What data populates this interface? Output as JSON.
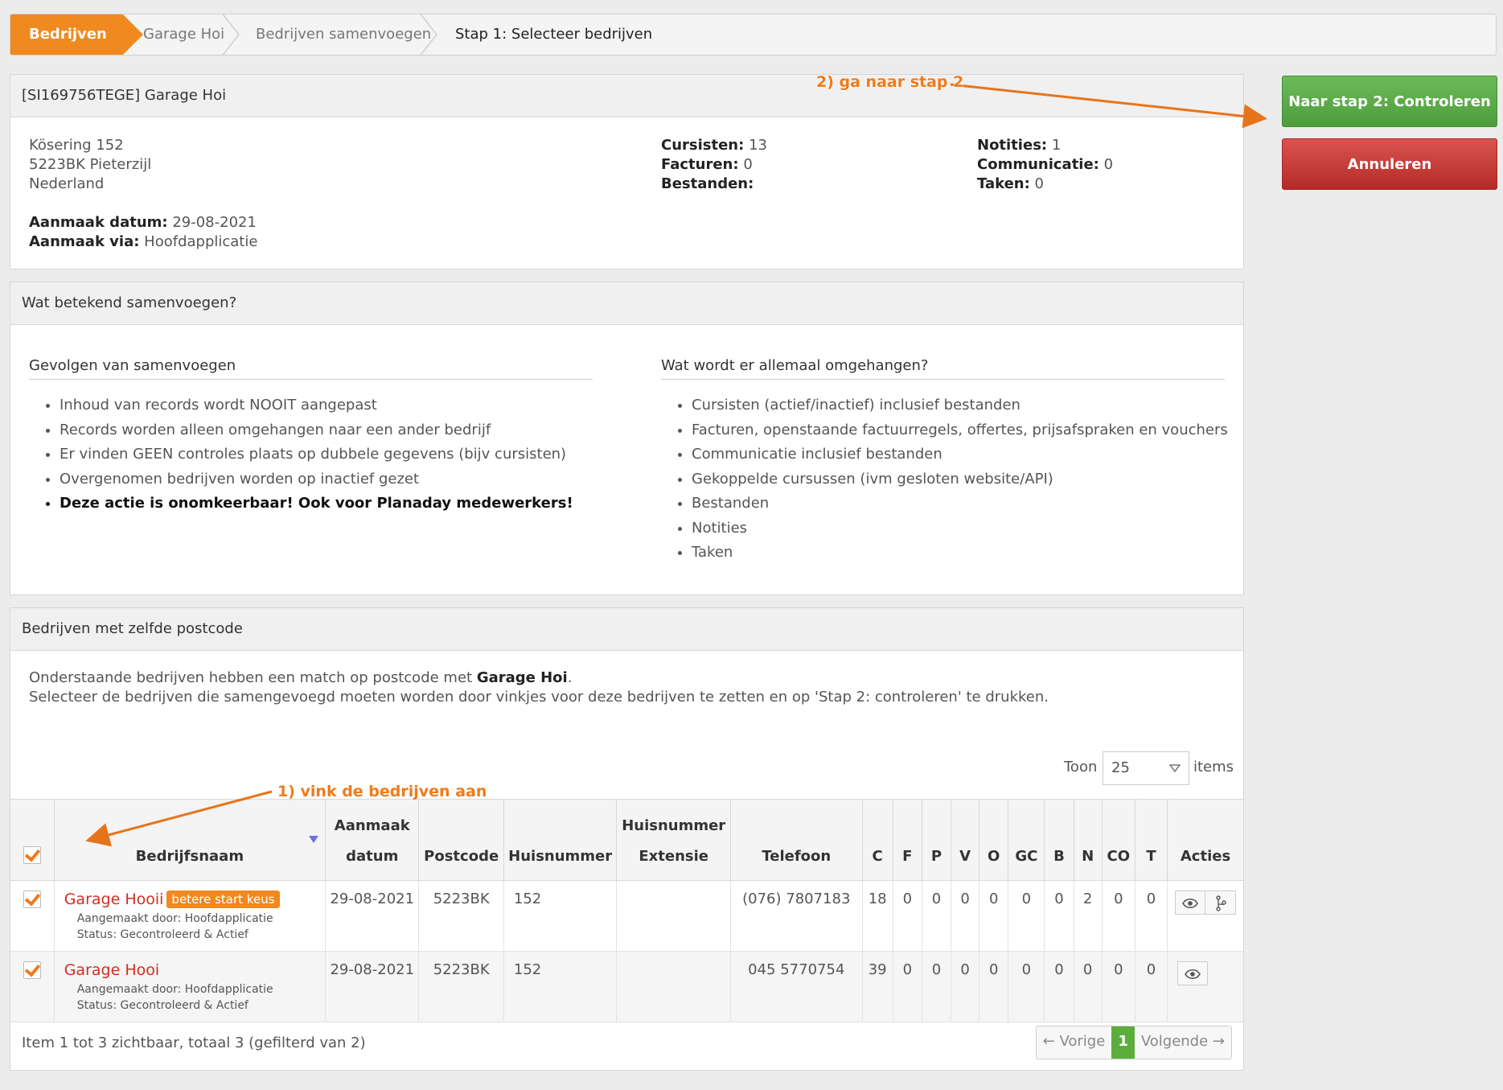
{
  "breadcrumb": [
    {
      "label": "Bedrijven"
    },
    {
      "label": "Garage Hoi"
    },
    {
      "label": "Bedrijven samenvoegen"
    },
    {
      "label": "Stap 1: Selecteer bedrijven"
    }
  ],
  "actions": {
    "next": "Naar stap 2: Controleren",
    "cancel": "Annuleren"
  },
  "annotations": {
    "step2": "2) ga naar stap 2",
    "step1": "1) vink de bedrijven aan"
  },
  "company": {
    "header": "[SI169756TEGE] Garage Hoi",
    "street": "Kösering 152",
    "city": "5223BK Pieterzijl",
    "country": "Nederland",
    "created_label": "Aanmaak datum:",
    "created_value": "29-08-2021",
    "via_label": "Aanmaak via:",
    "via_value": "Hoofdapplicatie",
    "stats": {
      "cursisten_label": "Cursisten:",
      "cursisten": "13",
      "facturen_label": "Facturen:",
      "facturen": "0",
      "bestanden_label": "Bestanden:",
      "notities_label": "Notities:",
      "notities": "1",
      "communicatie_label": "Communicatie:",
      "communicatie": "0",
      "taken_label": "Taken:",
      "taken": "0"
    }
  },
  "info": {
    "header": "Wat betekend samenvoegen?",
    "left_title": "Gevolgen van samenvoegen",
    "left_items": [
      "Inhoud van records wordt NOOIT aangepast",
      "Records worden alleen omgehangen naar een ander bedrijf",
      "Er vinden GEEN controles plaats op dubbele gegevens (bijv cursisten)",
      "Overgenomen bedrijven worden op inactief gezet",
      "Deze actie is onomkeerbaar! Ook voor Planaday medewerkers!"
    ],
    "right_title": "Wat wordt er allemaal omgehangen?",
    "right_items": [
      "Cursisten (actief/inactief) inclusief bestanden",
      "Facturen, openstaande factuurregels, offertes, prijsafspraken en vouchers",
      "Communicatie inclusief bestanden",
      "Gekoppelde cursussen (ivm gesloten website/API)",
      "Bestanden",
      "Notities",
      "Taken"
    ]
  },
  "matches": {
    "header": "Bedrijven met zelfde postcode",
    "intro_pre": "Onderstaande bedrijven hebben een match op postcode met ",
    "intro_company": "Garage Hoi",
    "intro_post": ".",
    "intro_line2": "Selecteer de bedrijven die samengevoegd moeten worden door vinkjes voor deze bedrijven te zetten en op 'Stap 2: controleren' te drukken.",
    "show_label": "Toon",
    "show_value": "25",
    "items_label": "items",
    "columns": {
      "name": "Bedrijfsnaam",
      "date": "Aanmaak datum",
      "postcode": "Postcode",
      "huisnummer": "Huisnummer",
      "extensie": "Huisnummer Extensie",
      "telefoon": "Telefoon",
      "c": "C",
      "f": "F",
      "p": "P",
      "v": "V",
      "o": "O",
      "gc": "GC",
      "b": "B",
      "n": "N",
      "co": "CO",
      "t": "T",
      "acties": "Acties"
    },
    "rows": [
      {
        "name": "Garage Hooii",
        "badge": "betere start keus",
        "created_by": "Aangemaakt door: Hoofdapplicatie",
        "status": "Status: Gecontroleerd & Actief",
        "date": "29-08-2021",
        "postcode": "5223BK",
        "huisnummer": "152",
        "extensie": "",
        "telefoon": "(076) 7807183",
        "c": "18",
        "f": "0",
        "p": "0",
        "v": "0",
        "o": "0",
        "gc": "0",
        "b": "0",
        "n": "2",
        "co": "0",
        "t": "0"
      },
      {
        "name": "Garage Hooi",
        "created_by": "Aangemaakt door: Hoofdapplicatie",
        "status": "Status: Gecontroleerd & Actief",
        "date": "29-08-2021",
        "postcode": "5223BK",
        "huisnummer": "152",
        "extensie": "",
        "telefoon": "045 5770754",
        "c": "39",
        "f": "0",
        "p": "0",
        "v": "0",
        "o": "0",
        "gc": "0",
        "b": "0",
        "n": "0",
        "co": "0",
        "t": "0"
      }
    ],
    "footer": "Item 1 tot 3 zichtbaar, totaal 3 (gefilterd van 2)",
    "pager": {
      "prev": "← Vorige",
      "current": "1",
      "next": "Volgende →"
    }
  },
  "colors": {
    "accent": "#f0891f",
    "primary": "#5cad3c",
    "danger": "#c9302c",
    "link": "#d42d20",
    "muted": "#bbbbbb"
  }
}
